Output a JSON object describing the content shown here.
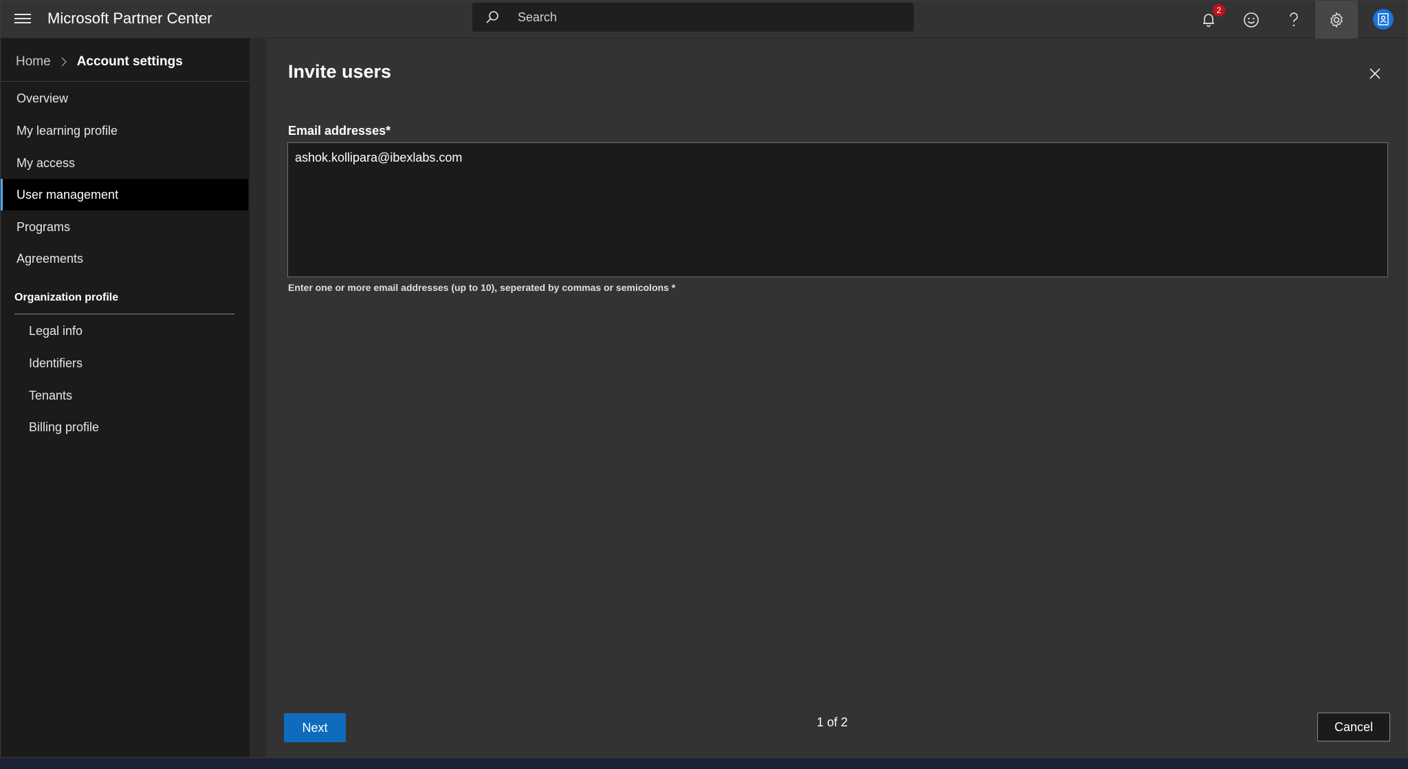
{
  "topbar": {
    "app_title": "Microsoft Partner Center",
    "search_placeholder": "Search",
    "notification_count": "2",
    "icons": [
      "hamburger-menu-icon",
      "search-icon",
      "bell-icon",
      "smiley-icon",
      "help-icon",
      "gear-icon",
      "avatar-icon"
    ]
  },
  "breadcrumb": {
    "home": "Home",
    "current": "Account settings"
  },
  "sidebar": {
    "items": [
      {
        "label": "Overview"
      },
      {
        "label": "My learning profile"
      },
      {
        "label": "My access"
      },
      {
        "label": "User management",
        "selected": true
      },
      {
        "label": "Programs"
      },
      {
        "label": "Agreements"
      }
    ],
    "section_title": "Organization profile",
    "sub_items": [
      {
        "label": "Legal info"
      },
      {
        "label": "Identifiers"
      },
      {
        "label": "Tenants"
      },
      {
        "label": "Billing profile"
      }
    ]
  },
  "panel": {
    "title": "Invite users",
    "email_label": "Email addresses",
    "required_mark": "*",
    "email_value": "ashok.kollipara@ibexlabs.com",
    "hint": "Enter one or more email addresses (up to 10), seperated by commas or semicolons *",
    "next_label": "Next",
    "step": "1 of 2",
    "cancel_label": "Cancel"
  },
  "colors": {
    "accent": "#0f6cbd",
    "selected_marker": "#58a6e8",
    "badge": "#c50f1f"
  }
}
